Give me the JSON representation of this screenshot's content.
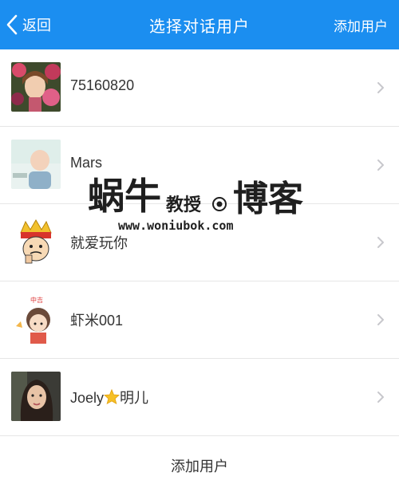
{
  "header": {
    "back_label": "返回",
    "title": "选择对话用户",
    "add_user_label": "添加用户",
    "background_color": "#1b8ef0"
  },
  "users": [
    {
      "name": "75160820",
      "avatar": "girl-with-flowers-avatar"
    },
    {
      "name": "Mars",
      "avatar": "baby-photo-avatar"
    },
    {
      "name": "就爱玩你",
      "avatar": "cartoon-king-avatar"
    },
    {
      "name": "虾米001",
      "avatar": "cartoon-girl-avatar",
      "avatar_caption": "中吉"
    },
    {
      "name_prefix": "Joely",
      "name_suffix": "明儿",
      "name_emoji": "star-emoji",
      "avatar": "woman-photo-avatar"
    }
  ],
  "footer": {
    "add_user_label": "添加用户"
  },
  "watermark": {
    "logo_text": "蜗牛教授博客",
    "url": "www.woniubok.com"
  }
}
